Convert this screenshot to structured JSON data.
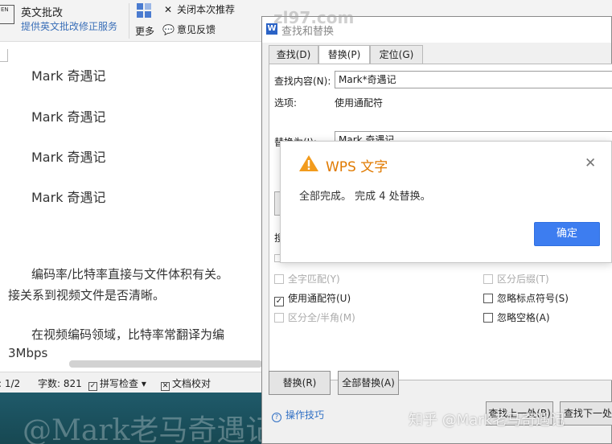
{
  "ribbon": {
    "icon_text": "EN",
    "title": "英文批改",
    "subtitle": "提供英文批改修正服务",
    "more": "更多",
    "close_recommend": "关闭本次推荐",
    "feedback": "意见反馈"
  },
  "document": {
    "lines": [
      "Mark 奇遇记",
      "Mark 奇遇记",
      "Mark 奇遇记",
      "Mark 奇遇记"
    ],
    "para1_line1": "编码率/比特率直接与文件体积有关。",
    "para1_line2": "接关系到视频文件是否清晰。",
    "para2_line1": "在视频编码领域，比特率常翻译为编",
    "para2_line2": "3Mbps"
  },
  "statusbar": {
    "page": "页: 1/2",
    "words": "字数: 821",
    "spell": "拼写检查",
    "proof": "文档校对"
  },
  "find_replace": {
    "title": "查找和替换",
    "tabs": [
      "查找(D)",
      "替换(P)",
      "定位(G)"
    ],
    "find_label": "查找内容(N):",
    "find_value": "Mark*奇遇记",
    "options_label": "选项:",
    "options_value": "使用通配符",
    "replace_label": "替换为(I):",
    "replace_value": "Mark 奇遇记",
    "search_label": "搜",
    "options": {
      "whole_word": "全字匹配(Y)",
      "wildcards": "使用通配符(U)",
      "full_half": "区分全/半角(M)",
      "suffix": "区分后缀(T)",
      "ignore_punct": "忽略标点符号(S)",
      "ignore_space": "忽略空格(A)"
    },
    "replace_btn": "替换(R)",
    "replace_all_btn": "全部替换(A)",
    "tips": "操作技巧",
    "find_prev": "查找上一处(B)",
    "find_next": "查找下一处(F)"
  },
  "message_box": {
    "title": "WPS 文字",
    "text": "全部完成。 完成 4 处替换。",
    "ok": "确定"
  },
  "watermarks": {
    "site": "zl97.com",
    "zhihu": "知乎 @Mark老马奇遇记",
    "doc": "@Mark老马奇遇记"
  }
}
